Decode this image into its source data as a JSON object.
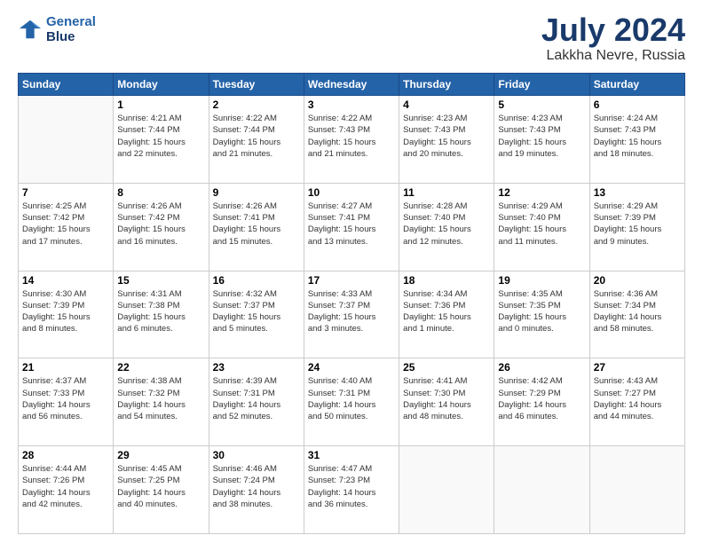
{
  "logo": {
    "line1": "General",
    "line2": "Blue"
  },
  "title": "July 2024",
  "location": "Lakkha Nevre, Russia",
  "days_of_week": [
    "Sunday",
    "Monday",
    "Tuesday",
    "Wednesday",
    "Thursday",
    "Friday",
    "Saturday"
  ],
  "weeks": [
    [
      {
        "day": "",
        "info": ""
      },
      {
        "day": "1",
        "info": "Sunrise: 4:21 AM\nSunset: 7:44 PM\nDaylight: 15 hours\nand 22 minutes."
      },
      {
        "day": "2",
        "info": "Sunrise: 4:22 AM\nSunset: 7:44 PM\nDaylight: 15 hours\nand 21 minutes."
      },
      {
        "day": "3",
        "info": "Sunrise: 4:22 AM\nSunset: 7:43 PM\nDaylight: 15 hours\nand 21 minutes."
      },
      {
        "day": "4",
        "info": "Sunrise: 4:23 AM\nSunset: 7:43 PM\nDaylight: 15 hours\nand 20 minutes."
      },
      {
        "day": "5",
        "info": "Sunrise: 4:23 AM\nSunset: 7:43 PM\nDaylight: 15 hours\nand 19 minutes."
      },
      {
        "day": "6",
        "info": "Sunrise: 4:24 AM\nSunset: 7:43 PM\nDaylight: 15 hours\nand 18 minutes."
      }
    ],
    [
      {
        "day": "7",
        "info": "Sunrise: 4:25 AM\nSunset: 7:42 PM\nDaylight: 15 hours\nand 17 minutes."
      },
      {
        "day": "8",
        "info": "Sunrise: 4:26 AM\nSunset: 7:42 PM\nDaylight: 15 hours\nand 16 minutes."
      },
      {
        "day": "9",
        "info": "Sunrise: 4:26 AM\nSunset: 7:41 PM\nDaylight: 15 hours\nand 15 minutes."
      },
      {
        "day": "10",
        "info": "Sunrise: 4:27 AM\nSunset: 7:41 PM\nDaylight: 15 hours\nand 13 minutes."
      },
      {
        "day": "11",
        "info": "Sunrise: 4:28 AM\nSunset: 7:40 PM\nDaylight: 15 hours\nand 12 minutes."
      },
      {
        "day": "12",
        "info": "Sunrise: 4:29 AM\nSunset: 7:40 PM\nDaylight: 15 hours\nand 11 minutes."
      },
      {
        "day": "13",
        "info": "Sunrise: 4:29 AM\nSunset: 7:39 PM\nDaylight: 15 hours\nand 9 minutes."
      }
    ],
    [
      {
        "day": "14",
        "info": "Sunrise: 4:30 AM\nSunset: 7:39 PM\nDaylight: 15 hours\nand 8 minutes."
      },
      {
        "day": "15",
        "info": "Sunrise: 4:31 AM\nSunset: 7:38 PM\nDaylight: 15 hours\nand 6 minutes."
      },
      {
        "day": "16",
        "info": "Sunrise: 4:32 AM\nSunset: 7:37 PM\nDaylight: 15 hours\nand 5 minutes."
      },
      {
        "day": "17",
        "info": "Sunrise: 4:33 AM\nSunset: 7:37 PM\nDaylight: 15 hours\nand 3 minutes."
      },
      {
        "day": "18",
        "info": "Sunrise: 4:34 AM\nSunset: 7:36 PM\nDaylight: 15 hours\nand 1 minute."
      },
      {
        "day": "19",
        "info": "Sunrise: 4:35 AM\nSunset: 7:35 PM\nDaylight: 15 hours\nand 0 minutes."
      },
      {
        "day": "20",
        "info": "Sunrise: 4:36 AM\nSunset: 7:34 PM\nDaylight: 14 hours\nand 58 minutes."
      }
    ],
    [
      {
        "day": "21",
        "info": "Sunrise: 4:37 AM\nSunset: 7:33 PM\nDaylight: 14 hours\nand 56 minutes."
      },
      {
        "day": "22",
        "info": "Sunrise: 4:38 AM\nSunset: 7:32 PM\nDaylight: 14 hours\nand 54 minutes."
      },
      {
        "day": "23",
        "info": "Sunrise: 4:39 AM\nSunset: 7:31 PM\nDaylight: 14 hours\nand 52 minutes."
      },
      {
        "day": "24",
        "info": "Sunrise: 4:40 AM\nSunset: 7:31 PM\nDaylight: 14 hours\nand 50 minutes."
      },
      {
        "day": "25",
        "info": "Sunrise: 4:41 AM\nSunset: 7:30 PM\nDaylight: 14 hours\nand 48 minutes."
      },
      {
        "day": "26",
        "info": "Sunrise: 4:42 AM\nSunset: 7:29 PM\nDaylight: 14 hours\nand 46 minutes."
      },
      {
        "day": "27",
        "info": "Sunrise: 4:43 AM\nSunset: 7:27 PM\nDaylight: 14 hours\nand 44 minutes."
      }
    ],
    [
      {
        "day": "28",
        "info": "Sunrise: 4:44 AM\nSunset: 7:26 PM\nDaylight: 14 hours\nand 42 minutes."
      },
      {
        "day": "29",
        "info": "Sunrise: 4:45 AM\nSunset: 7:25 PM\nDaylight: 14 hours\nand 40 minutes."
      },
      {
        "day": "30",
        "info": "Sunrise: 4:46 AM\nSunset: 7:24 PM\nDaylight: 14 hours\nand 38 minutes."
      },
      {
        "day": "31",
        "info": "Sunrise: 4:47 AM\nSunset: 7:23 PM\nDaylight: 14 hours\nand 36 minutes."
      },
      {
        "day": "",
        "info": ""
      },
      {
        "day": "",
        "info": ""
      },
      {
        "day": "",
        "info": ""
      }
    ]
  ]
}
